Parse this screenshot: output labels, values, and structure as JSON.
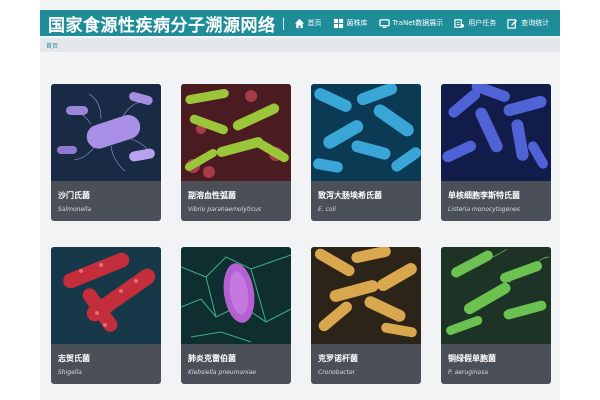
{
  "header": {
    "title": "国家食源性疾病分子溯源网络",
    "separator": "|",
    "nav": [
      {
        "label": "首页",
        "icon": "home-icon"
      },
      {
        "label": "菌株库",
        "icon": "grid-icon"
      },
      {
        "label": "TraNet数据展示",
        "icon": "monitor-icon"
      },
      {
        "label": "用户任务",
        "icon": "task-icon"
      },
      {
        "label": "查询统计",
        "icon": "edit-icon"
      }
    ]
  },
  "breadcrumb": {
    "home": "首页"
  },
  "colors": {
    "header": "#1f8c9a",
    "card": "#4b5058",
    "breadcrumb_bg": "#e4e8ec"
  },
  "cards": [
    {
      "name": "沙门氏菌",
      "sci": "Salmonella"
    },
    {
      "name": "副溶血性弧菌",
      "sci": "Vibrio parahaemolyticus"
    },
    {
      "name": "致泻大肠埃希氏菌",
      "sci": "E. coli"
    },
    {
      "name": "单核细胞李斯特氏菌",
      "sci": "Listeria monocytogenes"
    },
    {
      "name": "志贺氏菌",
      "sci": "Shigella"
    },
    {
      "name": "肺炎克雷伯菌",
      "sci": "Klebsiella pneumoniae"
    },
    {
      "name": "克罗诺杆菌",
      "sci": "Cronobacter"
    },
    {
      "name": "铜绿假单胞菌",
      "sci": "P. aeruginosa"
    }
  ]
}
